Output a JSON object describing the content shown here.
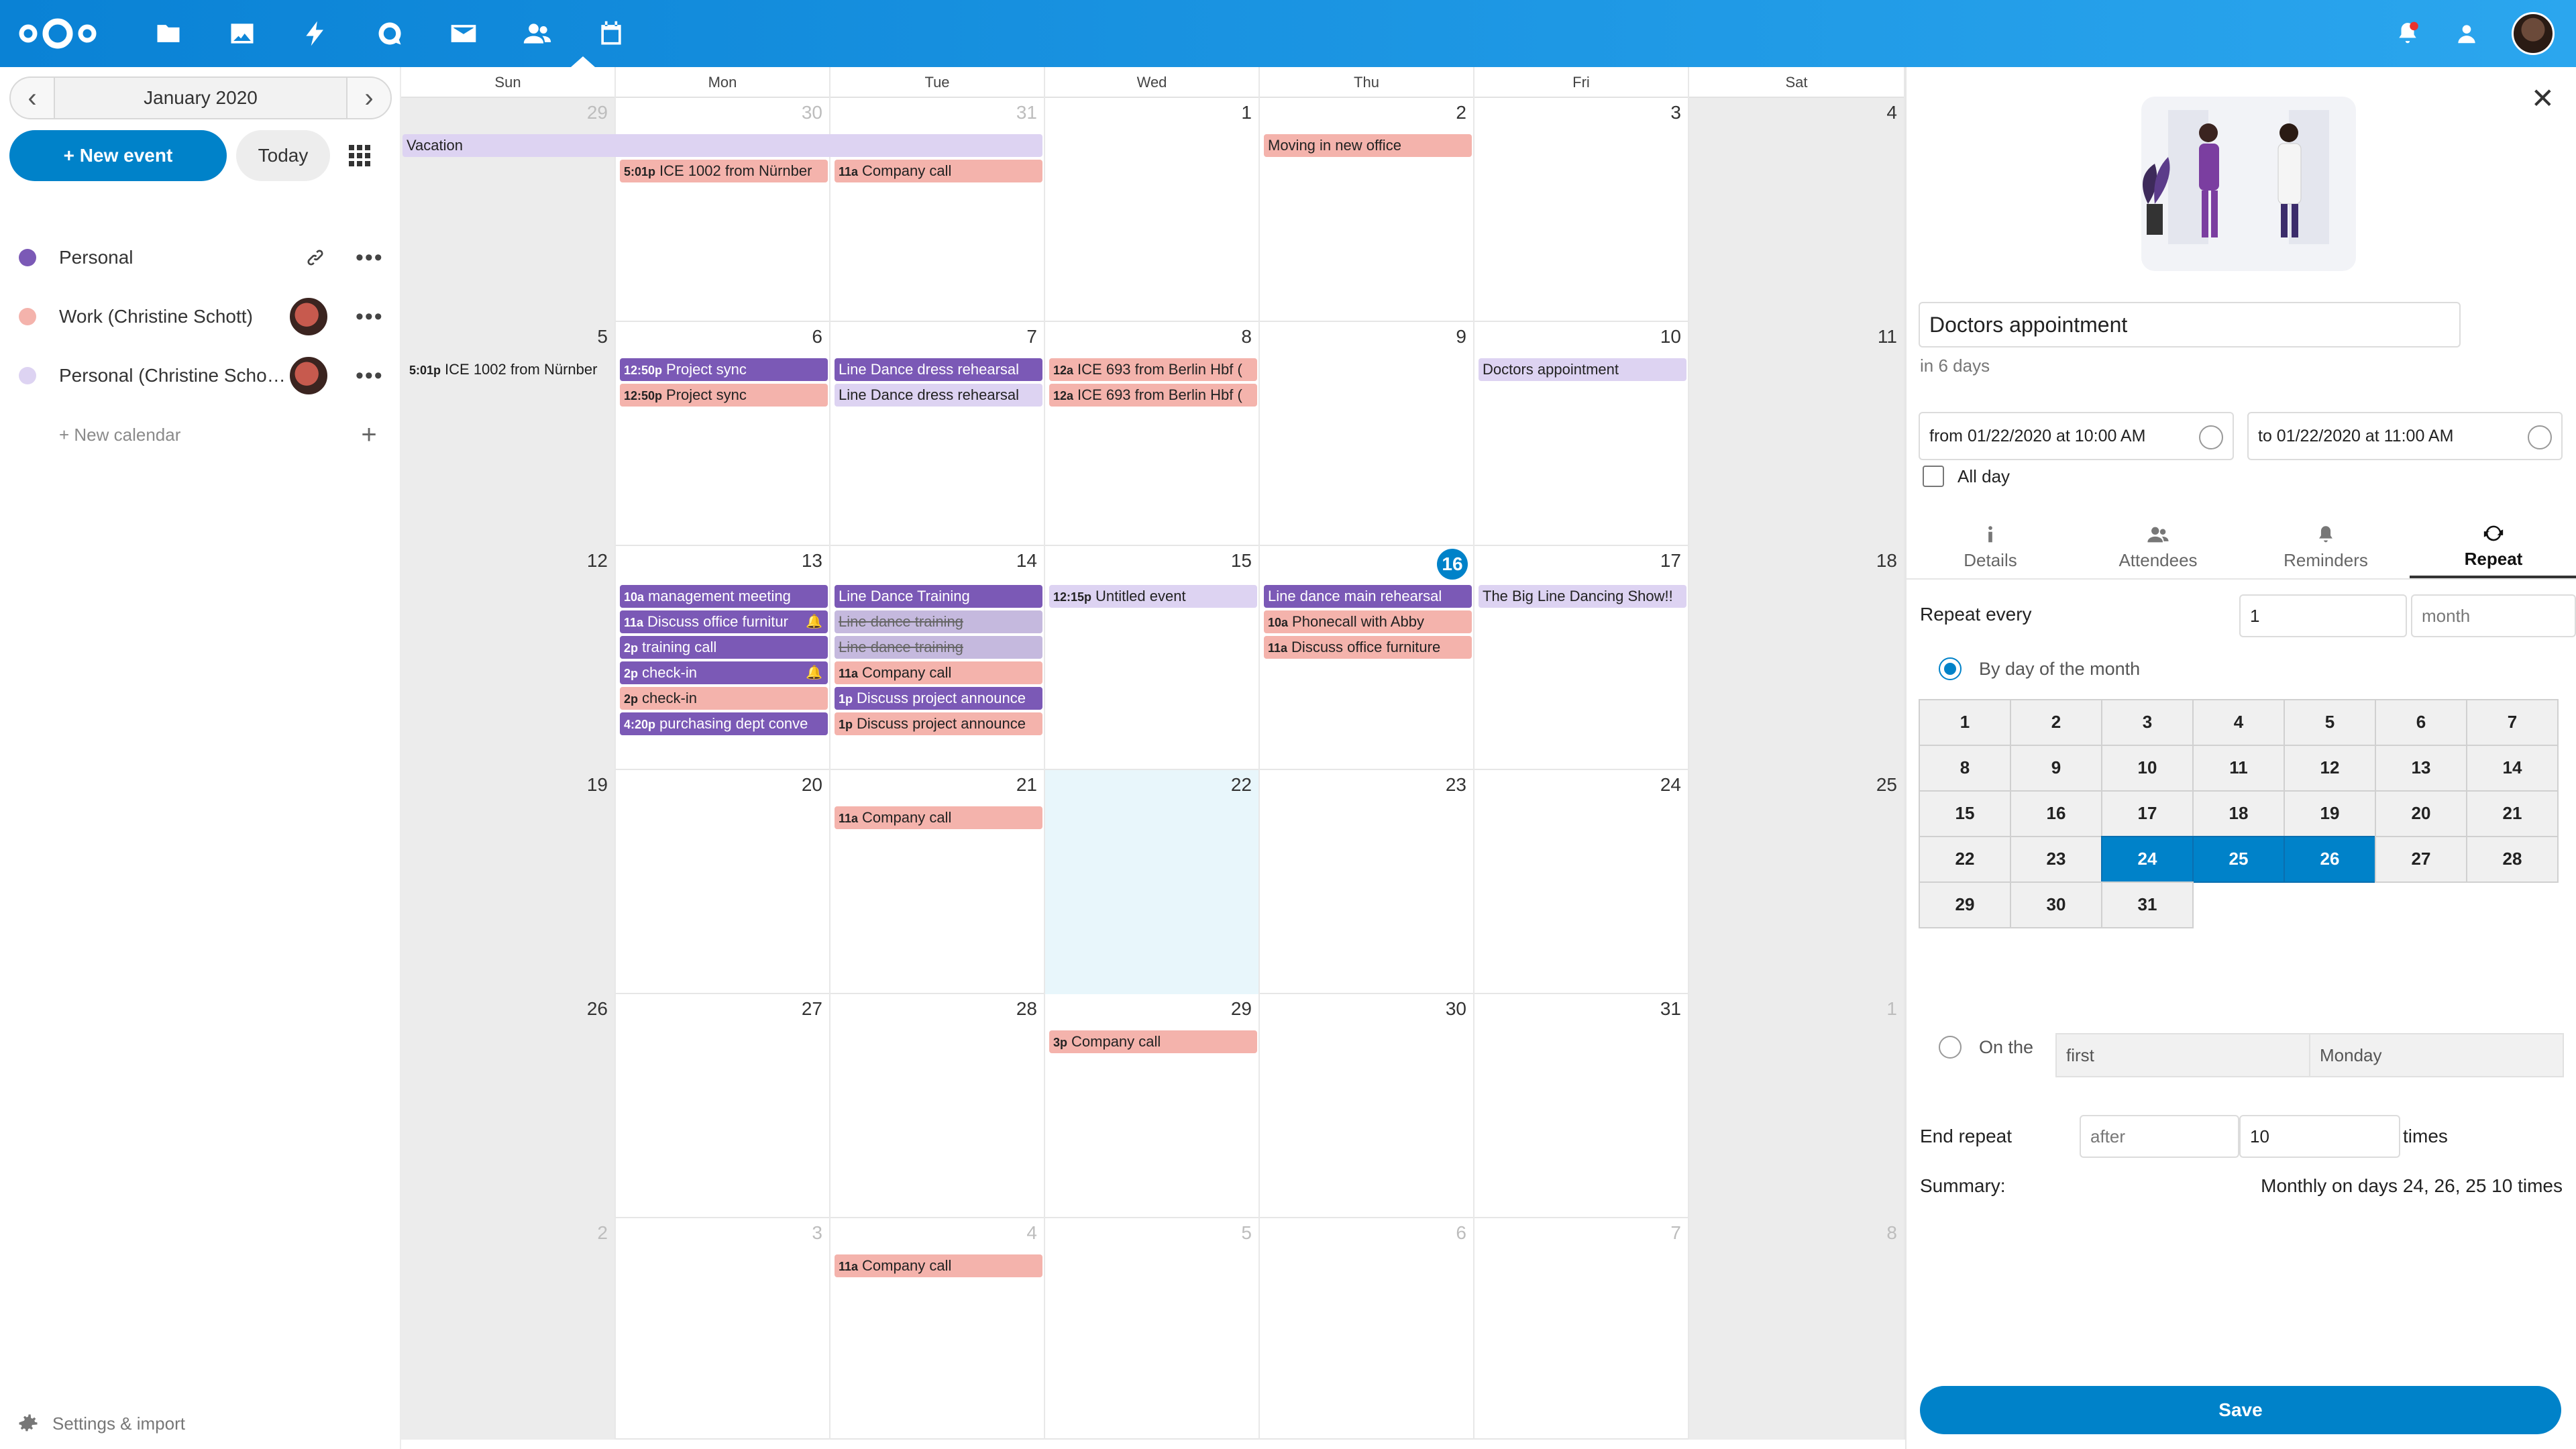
{
  "header": {
    "apps": [
      "files-icon",
      "photos-icon",
      "activity-icon",
      "talk-icon",
      "mail-icon",
      "contacts-icon",
      "calendar-icon"
    ],
    "right": [
      "notifications-icon",
      "contacts-menu-icon",
      "user-avatar"
    ]
  },
  "nav": {
    "month_label": "January 2020",
    "new_event": "+ New event",
    "today": "Today",
    "calendars": [
      {
        "name": "Personal",
        "color": "#7b59b6"
      },
      {
        "name": "Work (Christine Schott)",
        "color": "#f4b3ac"
      },
      {
        "name": "Personal (Christine Scho…",
        "color": "#ddd3f2"
      }
    ],
    "new_calendar": "+ New calendar",
    "settings": "Settings & import"
  },
  "calendar": {
    "day_headers": [
      "Sun",
      "Mon",
      "Tue",
      "Wed",
      "Thu",
      "Fri",
      "Sat"
    ],
    "weeks": [
      [
        "29",
        "30",
        "31",
        "1",
        "2",
        "3",
        "4"
      ],
      [
        "5",
        "6",
        "7",
        "8",
        "9",
        "10",
        "11"
      ],
      [
        "12",
        "13",
        "14",
        "15",
        "16",
        "17",
        "18"
      ],
      [
        "19",
        "20",
        "21",
        "22",
        "23",
        "24",
        "25"
      ],
      [
        "26",
        "27",
        "28",
        "29",
        "30",
        "31",
        "1"
      ],
      [
        "2",
        "3",
        "4",
        "5",
        "6",
        "7",
        "8"
      ]
    ],
    "events": {
      "vacation": "Vacation",
      "ice_1002_a": {
        "time": "5:01p",
        "label": "ICE 1002 from Nürnber"
      },
      "company_call_a": {
        "time": "11a",
        "label": "Company call"
      },
      "moving_office": "Moving in new office",
      "ice_1002_b": {
        "time": "5:01p",
        "label": "ICE 1002 from Nürnber"
      },
      "project_sync_1": {
        "time": "12:50p",
        "label": "Project sync"
      },
      "project_sync_2": {
        "time": "12:50p",
        "label": "Project sync"
      },
      "line_dance_1": "Line Dance dress rehearsal",
      "line_dance_2": "Line Dance dress rehearsal",
      "ice_693_1": {
        "time": "12a",
        "label": "ICE 693 from Berlin Hbf ("
      },
      "ice_693_2": {
        "time": "12a",
        "label": "ICE 693 from Berlin Hbf ("
      },
      "doctors": "Doctors appointment",
      "mgmt": {
        "time": "10a",
        "label": "management meeting"
      },
      "office_furn_1": {
        "time": "11a",
        "label": "Discuss office furnitur"
      },
      "training_call": {
        "time": "2p",
        "label": "training call"
      },
      "checkin_1": {
        "time": "2p",
        "label": "check-in"
      },
      "checkin_2": {
        "time": "2p",
        "label": "check-in"
      },
      "purchasing": {
        "time": "4:20p",
        "label": "purchasing dept conve"
      },
      "ld_training": "Line Dance Training",
      "ld_training_s1": "Line dance training",
      "ld_training_s2": "Line dance training",
      "company_call_b": {
        "time": "11a",
        "label": "Company call"
      },
      "discuss_proj_1": {
        "time": "1p",
        "label": "Discuss project announce"
      },
      "discuss_proj_2": {
        "time": "1p",
        "label": "Discuss project announce"
      },
      "untitled": {
        "time": "12:15p",
        "label": "Untitled event"
      },
      "ld_main": "Line dance main rehearsal",
      "phonecall": {
        "time": "10a",
        "label": "Phonecall with Abby"
      },
      "office_furn_2": {
        "time": "11a",
        "label": "Discuss office furniture"
      },
      "big_show": "The Big Line Dancing Show!!",
      "company_call_c": {
        "time": "11a",
        "label": "Company call"
      },
      "company_call_d": {
        "time": "3p",
        "label": "Company call"
      },
      "company_call_e": {
        "time": "11a",
        "label": "Company call"
      }
    }
  },
  "sidebar": {
    "title": "Doctors appointment",
    "in_days": "in 6 days",
    "from": "from 01/22/2020 at 10:00 AM",
    "to": "to 01/22/2020 at 11:00 AM",
    "all_day": "All day",
    "tabs": [
      "Details",
      "Attendees",
      "Reminders",
      "Repeat"
    ],
    "repeat_every_label": "Repeat every",
    "repeat_every_value": "1",
    "repeat_unit": "month",
    "by_day_label": "By day of the month",
    "days": [
      "1",
      "2",
      "3",
      "4",
      "5",
      "6",
      "7",
      "8",
      "9",
      "10",
      "11",
      "12",
      "13",
      "14",
      "15",
      "16",
      "17",
      "18",
      "19",
      "20",
      "21",
      "22",
      "23",
      "24",
      "25",
      "26",
      "27",
      "28",
      "29",
      "30",
      "31"
    ],
    "selected_days": [
      "24",
      "25",
      "26"
    ],
    "on_the_label": "On the",
    "on_the_first": "first",
    "on_the_day": "Monday",
    "end_repeat_label": "End repeat",
    "end_repeat_mode": "after",
    "end_repeat_count": "10",
    "times_label": "times",
    "summary_label": "Summary:",
    "summary_value": "Monthly on days 24, 26, 25 10 times",
    "save": "Save"
  }
}
